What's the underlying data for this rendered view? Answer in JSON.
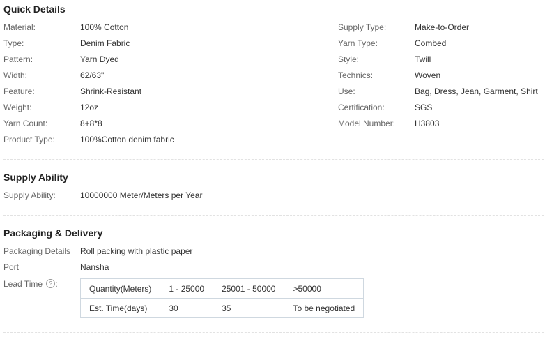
{
  "quick_details": {
    "title": "Quick Details",
    "left": [
      {
        "label": "Material:",
        "value": "100% Cotton"
      },
      {
        "label": "Type:",
        "value": "Denim Fabric"
      },
      {
        "label": "Pattern:",
        "value": "Yarn Dyed"
      },
      {
        "label": "Width:",
        "value": "62/63\""
      },
      {
        "label": "Feature:",
        "value": "Shrink-Resistant"
      },
      {
        "label": "Weight:",
        "value": "12oz"
      },
      {
        "label": "Yarn Count:",
        "value": "8+8*8"
      },
      {
        "label": "Product Type:",
        "value": "100%Cotton denim fabric"
      }
    ],
    "right": [
      {
        "label": "Supply Type:",
        "value": "Make-to-Order"
      },
      {
        "label": "Yarn Type:",
        "value": "Combed"
      },
      {
        "label": "Style:",
        "value": "Twill"
      },
      {
        "label": "Technics:",
        "value": "Woven"
      },
      {
        "label": "Use:",
        "value": "Bag, Dress, Jean, Garment, Shirt"
      },
      {
        "label": "Certification:",
        "value": "SGS"
      },
      {
        "label": "Model Number:",
        "value": "H3803"
      }
    ]
  },
  "supply_ability": {
    "title": "Supply Ability",
    "label": "Supply Ability:",
    "value": "10000000 Meter/Meters per Year"
  },
  "packaging": {
    "title": "Packaging & Delivery",
    "details_label": "Packaging Details",
    "details_value": "Roll packing with plastic paper",
    "port_label": "Port",
    "port_value": "Nansha",
    "lead_time_label": "Lead Time",
    "help_icon": "question-circle-icon",
    "help_glyph": "?",
    "table": {
      "rows": [
        [
          "Quantity(Meters)",
          "1 - 25000",
          "25001 - 50000",
          ">50000"
        ],
        [
          "Est. Time(days)",
          "30",
          "35",
          "To be negotiated"
        ]
      ]
    }
  }
}
